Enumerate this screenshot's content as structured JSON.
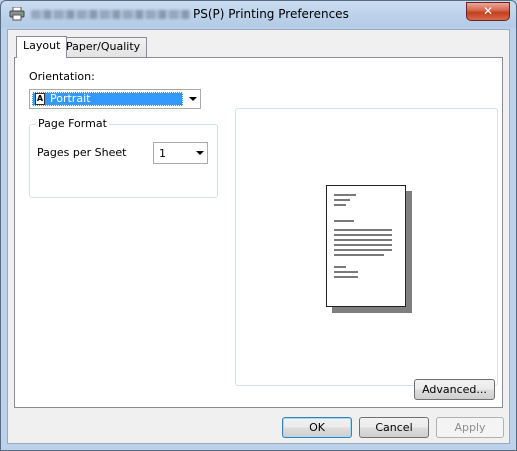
{
  "window": {
    "title": "PS(P) Printing Preferences",
    "close_label": "✕"
  },
  "tabs": [
    {
      "label": "Layout",
      "active": true
    },
    {
      "label": "Paper/Quality",
      "active": false
    }
  ],
  "layout": {
    "orientation_label": "Orientation:",
    "orientation_value": "Portrait",
    "orientation_icon_glyph": "A",
    "page_format_legend": "Page Format",
    "pages_per_sheet_label": "Pages per Sheet",
    "pages_per_sheet_value": "1"
  },
  "buttons": {
    "advanced": "Advanced...",
    "ok": "OK",
    "cancel": "Cancel",
    "apply": "Apply"
  },
  "colors": {
    "selection": "#3399ff",
    "close_button": "#c2401f"
  },
  "icons": [
    "printer-icon",
    "portrait-icon",
    "chevron-down-icon",
    "close-icon",
    "page-preview-icon"
  ]
}
